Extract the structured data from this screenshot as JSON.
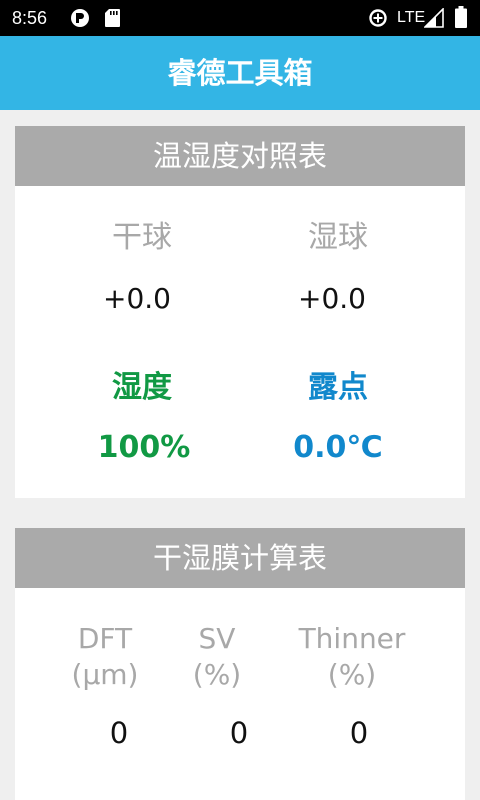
{
  "status_bar": {
    "time": "8:56",
    "network": "LTE",
    "app_icon": "app-notification-icon",
    "sd_icon": "sd-card-icon",
    "sync_icon": "data-saver-icon",
    "signal_icon": "cell-signal-icon",
    "battery_icon": "battery-icon"
  },
  "app_bar": {
    "title": "睿德工具箱",
    "color": "#33b5e5"
  },
  "humidity_table": {
    "title": "温湿度对照表",
    "dry_bulb_label": "干球",
    "dry_bulb_value": "+0.0",
    "wet_bulb_label": "湿球",
    "wet_bulb_value": "+0.0",
    "humidity_label": "湿度",
    "humidity_value": "100%",
    "humidity_color": "#119944",
    "dew_point_label": "露点",
    "dew_point_value": "0.0℃",
    "dew_point_color": "#1188cc"
  },
  "film_table": {
    "title": "干湿膜计算表",
    "columns": [
      {
        "label_line1": "DFT",
        "label_line2": "(μm)",
        "value": "0"
      },
      {
        "label_line1": "SV",
        "label_line2": "(%)",
        "value": "0"
      },
      {
        "label_line1": "Thinner",
        "label_line2": "(%)",
        "value": "0"
      }
    ]
  }
}
